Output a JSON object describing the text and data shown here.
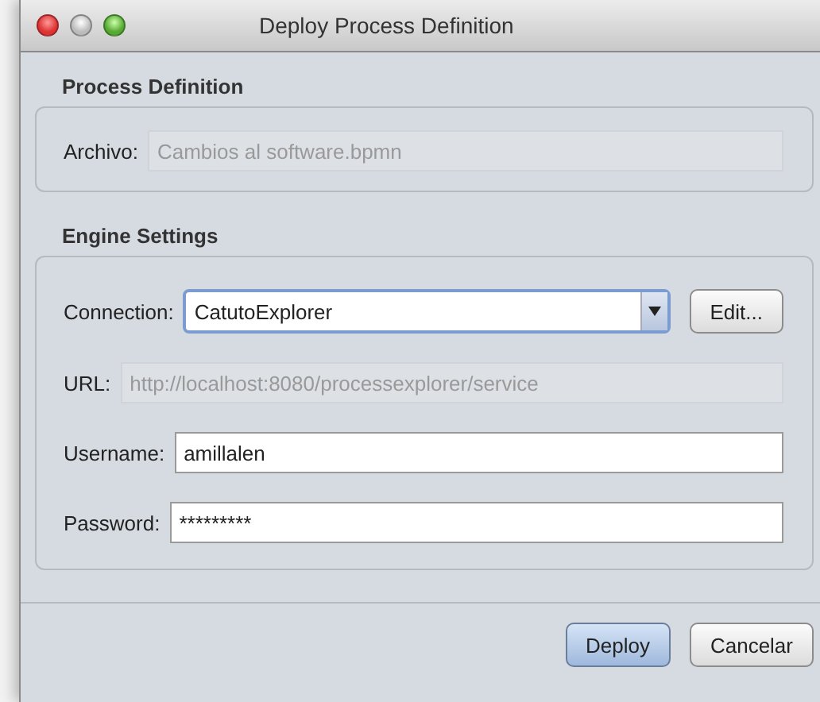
{
  "window": {
    "title": "Deploy Process Definition"
  },
  "sections": [
    {
      "title": "Process Definition",
      "fields": [
        {
          "kind": "text",
          "label": "Archivo:",
          "value": "Cambios al software.bpmn",
          "disabled": true
        }
      ]
    },
    {
      "title": "Engine Settings",
      "fields": [
        {
          "kind": "combo",
          "label": "Connection:",
          "value": "CatutoExplorer",
          "disabled": false,
          "button": "Edit..."
        },
        {
          "kind": "text",
          "label": "URL:",
          "value": "http://localhost:8080/processexplorer/service",
          "disabled": true
        },
        {
          "kind": "text",
          "label": "Username:",
          "value": "amillalen",
          "disabled": false
        },
        {
          "kind": "text",
          "label": "Password:",
          "value": "*********",
          "disabled": false
        }
      ]
    }
  ],
  "buttons": [
    {
      "label": "Deploy",
      "default": true
    },
    {
      "label": "Cancelar",
      "default": false
    }
  ]
}
